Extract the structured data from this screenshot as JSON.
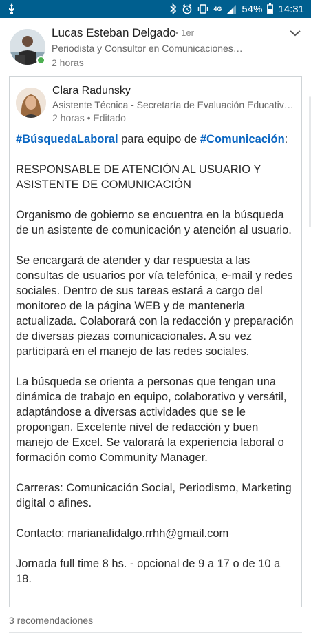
{
  "status_bar": {
    "battery_percent": "54%",
    "time": "14:31",
    "network_label": "4G",
    "volte_label": "4G"
  },
  "post": {
    "author_name": "Lucas Esteban Delgado",
    "connection_degree": "• 1er",
    "author_headline": "Periodista y Consultor en Comunicaciones…",
    "time": "2 horas"
  },
  "shared_post": {
    "author_name": "Clara Radunsky",
    "author_headline": "Asistente Técnica - Secretaría de Evaluación Educativa…",
    "time": "2 horas • Editado",
    "hashtag_1": "#BúsquedaLaboral",
    "text_1": " para equipo de ",
    "hashtag_2": "#Comunicación",
    "text_2": ":",
    "job_title_line1": "RESPONSABLE DE ATENCIÓN AL USUARIO Y",
    "job_title_line2": "ASISTENTE DE COMUNICACIÓN",
    "paragraph_1": "Organismo de gobierno se encuentra en la búsqueda de un asistente de comunicación y atención al usuario.",
    "paragraph_2": "Se encargará de atender y dar respuesta a las consultas de usuarios por vía telefónica, e-mail y redes sociales. Dentro de sus tareas estará a cargo del monitoreo de la página WEB y de mantenerla actualizada. Colaborará con la redacción y preparación de diversas piezas comunicacionales. A su vez participará en el manejo de las redes sociales.",
    "paragraph_3": "La búsqueda se orienta a personas que tengan una dinámica de trabajo en equipo, colaborativo y versátil, adaptándose a diversas actividades que se le propongan. Excelente nivel de redacción y buen manejo de Excel. Se valorará la experiencia laboral o formación como Community Manager.",
    "paragraph_4": "Carreras: Comunicación Social, Periodismo, Marketing digital o afines.",
    "paragraph_5": "Contacto: marianafidalgo.rrhh@gmail.com",
    "paragraph_6": "Jornada full time 8 hs. - opcional de 9 a 17 o de 10 a 18."
  },
  "reactions": {
    "count_label": "3 recomendaciones"
  },
  "icons": {
    "status_left": "notification-icon",
    "bluetooth": "bluetooth-icon",
    "alarm": "alarm-icon",
    "vibrate": "vibrate-icon",
    "signal": "signal-icon",
    "menu": "chevron-down-icon"
  },
  "colors": {
    "status_bar": "#005f8f",
    "hashtag": "#0a66c2",
    "online": "#4caf50"
  }
}
